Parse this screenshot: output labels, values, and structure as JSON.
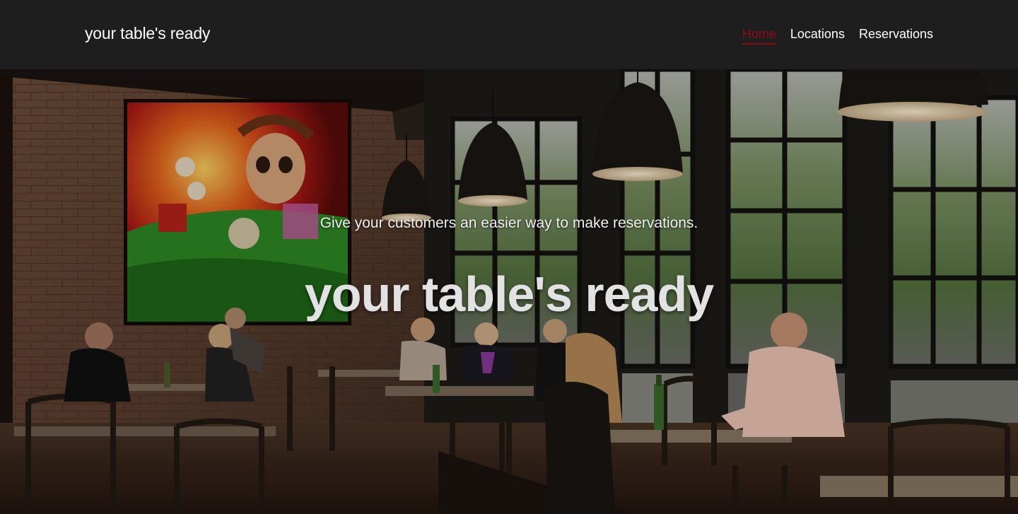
{
  "navbar": {
    "brand": "your table's ready",
    "links": [
      {
        "label": "Home",
        "active": true
      },
      {
        "label": "Locations",
        "active": false
      },
      {
        "label": "Reservations",
        "active": false
      }
    ]
  },
  "hero": {
    "tagline": "Give your customers an easier way to make reservations.",
    "title": "your table's ready",
    "background_image": "restaurant-interior-photo"
  },
  "colors": {
    "navbar_bg": "#1e1e1e",
    "active_link": "#8b0d12",
    "text": "#ffffff"
  }
}
